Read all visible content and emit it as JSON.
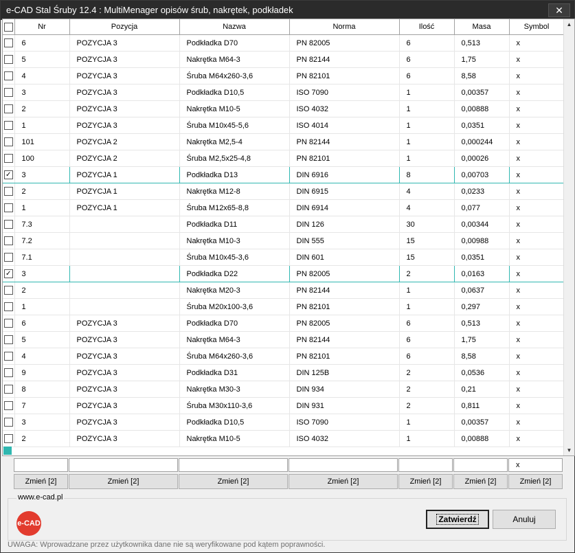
{
  "window": {
    "title": "e-CAD Stal Śruby 12.4 : MultiMenager opisów śrub, nakrętek, podkładek",
    "close_glyph": "✕"
  },
  "columns": [
    "Nr",
    "Pozycja",
    "Nazwa",
    "Norma",
    "Ilość",
    "Masa",
    "Symbol"
  ],
  "rows": [
    {
      "checked": false,
      "cells": [
        "6",
        "POZYCJA 3",
        "Podkładka D70",
        "PN 82005",
        "6",
        "0,513",
        "x"
      ]
    },
    {
      "checked": false,
      "cells": [
        "5",
        "POZYCJA 3",
        "Nakrętka M64-3",
        "PN 82144",
        "6",
        "1,75",
        "x"
      ]
    },
    {
      "checked": false,
      "cells": [
        "4",
        "POZYCJA 3",
        "Śruba M64x260-3,6",
        "PN 82101",
        "6",
        "8,58",
        "x"
      ]
    },
    {
      "checked": false,
      "cells": [
        "3",
        "POZYCJA 3",
        "Podkładka D10,5",
        "ISO 7090",
        "1",
        "0,00357",
        "x"
      ]
    },
    {
      "checked": false,
      "cells": [
        "2",
        "POZYCJA 3",
        "Nakrętka M10-5",
        "ISO 4032",
        "1",
        "0,00888",
        "x"
      ]
    },
    {
      "checked": false,
      "cells": [
        "1",
        "POZYCJA 3",
        "Śruba M10x45-5,6",
        "ISO 4014",
        "1",
        "0,0351",
        "x"
      ]
    },
    {
      "checked": false,
      "cells": [
        "101",
        "POZYCJA 2",
        "Nakrętka M2,5-4",
        "PN 82144",
        "1",
        "0,000244",
        "x"
      ]
    },
    {
      "checked": false,
      "cells": [
        "100",
        "POZYCJA 2",
        "Śruba M2,5x25-4,8",
        "PN 82101",
        "1",
        "0,00026",
        "x"
      ]
    },
    {
      "checked": true,
      "selected": true,
      "cells": [
        "3",
        "POZYCJA 1",
        "Podkładka D13",
        "DIN 6916",
        "8",
        "0,00703",
        "x"
      ]
    },
    {
      "checked": false,
      "cells": [
        "2",
        "POZYCJA 1",
        "Nakrętka M12-8",
        "DIN 6915",
        "4",
        "0,0233",
        "x"
      ]
    },
    {
      "checked": false,
      "cells": [
        "1",
        "POZYCJA 1",
        "Śruba M12x65-8,8",
        "DIN 6914",
        "4",
        "0,077",
        "x"
      ]
    },
    {
      "checked": false,
      "cells": [
        "7.3",
        "",
        "Podkładka D11",
        "DIN 126",
        "30",
        "0,00344",
        "x"
      ]
    },
    {
      "checked": false,
      "cells": [
        "7.2",
        "",
        "Nakrętka M10-3",
        "DIN 555",
        "15",
        "0,00988",
        "x"
      ]
    },
    {
      "checked": false,
      "cells": [
        "7.1",
        "",
        "Śruba M10x45-3,6",
        "DIN 601",
        "15",
        "0,0351",
        "x"
      ]
    },
    {
      "checked": true,
      "selected": true,
      "cells": [
        "3",
        "",
        "Podkładka D22",
        "PN 82005",
        "2",
        "0,0163",
        "x"
      ]
    },
    {
      "checked": false,
      "cells": [
        "2",
        "",
        "Nakrętka M20-3",
        "PN 82144",
        "1",
        "0,0637",
        "x"
      ]
    },
    {
      "checked": false,
      "cells": [
        "1",
        "",
        "Śruba M20x100-3,6",
        "PN 82101",
        "1",
        "0,297",
        "x"
      ]
    },
    {
      "checked": false,
      "cells": [
        "6",
        "POZYCJA 3",
        "Podkładka D70",
        "PN 82005",
        "6",
        "0,513",
        "x"
      ]
    },
    {
      "checked": false,
      "cells": [
        "5",
        "POZYCJA 3",
        "Nakrętka M64-3",
        "PN 82144",
        "6",
        "1,75",
        "x"
      ]
    },
    {
      "checked": false,
      "cells": [
        "4",
        "POZYCJA 3",
        "Śruba M64x260-3,6",
        "PN 82101",
        "6",
        "8,58",
        "x"
      ]
    },
    {
      "checked": false,
      "cells": [
        "9",
        "POZYCJA 3",
        "Podkładka D31",
        "DIN 125B",
        "2",
        "0,0536",
        "x"
      ]
    },
    {
      "checked": false,
      "cells": [
        "8",
        "POZYCJA 3",
        "Nakrętka M30-3",
        "DIN 934",
        "2",
        "0,21",
        "x"
      ]
    },
    {
      "checked": false,
      "cells": [
        "7",
        "POZYCJA 3",
        "Śruba M30x110-3,6",
        "DIN 931",
        "2",
        "0,811",
        "x"
      ]
    },
    {
      "checked": false,
      "cells": [
        "3",
        "POZYCJA 3",
        "Podkładka D10,5",
        "ISO 7090",
        "1",
        "0,00357",
        "x"
      ]
    },
    {
      "checked": false,
      "cells": [
        "2",
        "POZYCJA 3",
        "Nakrętka M10-5",
        "ISO 4032",
        "1",
        "0,00888",
        "x"
      ]
    }
  ],
  "edit_values": [
    "",
    "",
    "",
    "",
    "",
    "",
    "x"
  ],
  "change_buttons": [
    "Zmień [2]",
    "Zmień [2]",
    "Zmień [2]",
    "Zmień [2]",
    "Zmień [2]",
    "Zmień [2]",
    "Zmień [2]"
  ],
  "group_legend": "www.e-cad.pl",
  "logo_text": "e-CAD",
  "buttons": {
    "confirm": "Zatwierdź",
    "cancel": "Anuluj"
  },
  "warning": "UWAGA: Wprowadzane przez użytkownika dane nie są weryfikowane pod kątem poprawności.",
  "colors": {
    "selection": "#2fb7b0",
    "logo": "#e23b2e",
    "titlebar": "#2b2b2b"
  }
}
